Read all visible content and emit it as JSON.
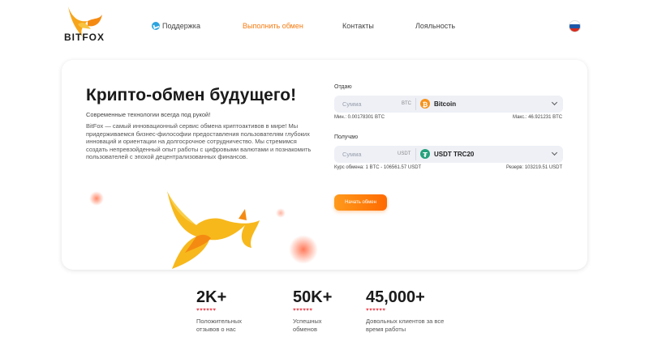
{
  "header": {
    "logo_text": "BITFOX",
    "nav": [
      {
        "label": "Поддержка"
      },
      {
        "label": "Выполнить обмен"
      },
      {
        "label": "Контакты"
      },
      {
        "label": "Лояльность"
      }
    ],
    "flag_colors": [
      "#ffffff",
      "#1c57a7",
      "#d52b1e"
    ]
  },
  "hero": {
    "title": "Крипто-обмен будущего!",
    "subtitle": "Современные технологии всегда под рукой!",
    "description": "BitFox — самый инновационный сервис обмена криптоактивов в мире! Мы придерживаемся бизнес-философии предоставления пользователям глубоких инноваций и ориентации на долгосрочное сотрудничество. Мы стремимся создать непревзойденный опыт работы с цифровыми валютами и познакомить пользователей с эпохой децентрализованных финансов."
  },
  "exchange": {
    "give": {
      "label": "Отдаю",
      "placeholder": "Сумма",
      "currency": "BTC",
      "coin_name": "Bitcoin",
      "coin_color": "#f7931a",
      "min": "Мин.: 0.00178301 BTC",
      "max": "Макс.: 46.921231 BTC"
    },
    "get": {
      "label": "Получаю",
      "placeholder": "Сумма",
      "currency": "USDT",
      "coin_name": "USDT TRC20",
      "coin_color": "#26a17b",
      "rate": "Курс обмена: 1 BTC - 106561.57 USDT",
      "reserve": "Резерв: 103219.51 USDT"
    },
    "button_label": "Начать обмен"
  },
  "stats": [
    {
      "value": "2K+",
      "hearts": "♥♥♥♥♥♥",
      "label_line1": "Положительных",
      "label_line2": "отзывов о нас"
    },
    {
      "value": "50K+",
      "hearts": "♥♥♥♥♥♥",
      "label_line1": "Успешных",
      "label_line2": "обменов"
    },
    {
      "value": "45,000+",
      "hearts": "♥♥♥♥♥♥",
      "label_line1": "Довольных клиентов за все",
      "label_line2": "время работы"
    }
  ],
  "colors": {
    "accent": "#f57b10",
    "fox_yellow": "#f7b81c",
    "heart": "#ef4b56"
  }
}
